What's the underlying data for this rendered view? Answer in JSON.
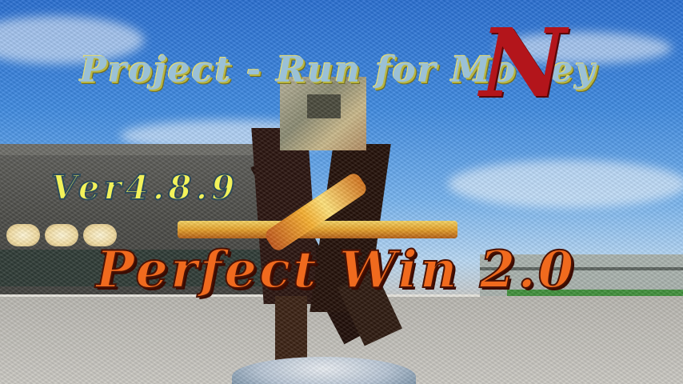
{
  "banner": {
    "title": "Project - Run for Mo",
    "title_tail": "ey",
    "title_emblem_letter": "N",
    "version": "Ver4.8.9",
    "headline": "Perfect Win 2.0"
  },
  "colors": {
    "title": "#9bc1d6",
    "emblem": "#b3151b",
    "version": "#f2f25a",
    "headline": "#f06a1e"
  }
}
